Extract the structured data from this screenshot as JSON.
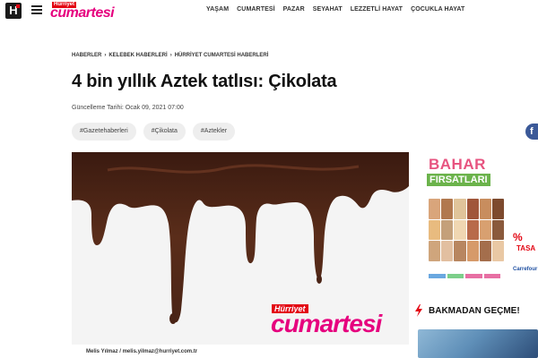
{
  "header": {
    "logo_letter": "H",
    "brand_top": "Hürriyet",
    "brand_main": "cumartesi",
    "nav": [
      "YAŞAM",
      "CUMARTESİ",
      "PAZAR",
      "SEYAHAT",
      "LEZZETLİ HAYAT",
      "ÇOCUKLA HAYAT"
    ]
  },
  "breadcrumb": [
    "HABERLER",
    "KELEBEK HABERLERİ",
    "HÜRRİYET CUMARTESİ HABERLERİ"
  ],
  "article": {
    "title": "4 bin yıllık Aztek tatlısı: Çikolata",
    "updated": "Güncelleme Tarihi: Ocak 09, 2021 07:00",
    "tags": [
      "#Gazetehaberleri",
      "#Çikolata",
      "#Aztekler"
    ],
    "image_brand_top": "Hürriyet",
    "image_brand_main": "cumartesi",
    "author": "Melis Yılmaz / melis.yilmaz@hurriyet.com.tr"
  },
  "social": {
    "facebook_letter": "f"
  },
  "ad": {
    "title_line1": "BAHAR",
    "title_line2": "FIRSATLARI",
    "percent": "%",
    "side_text": "TASA",
    "store": "Carrefour"
  },
  "sidebar": {
    "must_see": "BAKMADAN GEÇME!"
  },
  "colors": {
    "brand_pink": "#e6007e",
    "brand_red": "#e30613",
    "chocolate": "#4a2416"
  }
}
